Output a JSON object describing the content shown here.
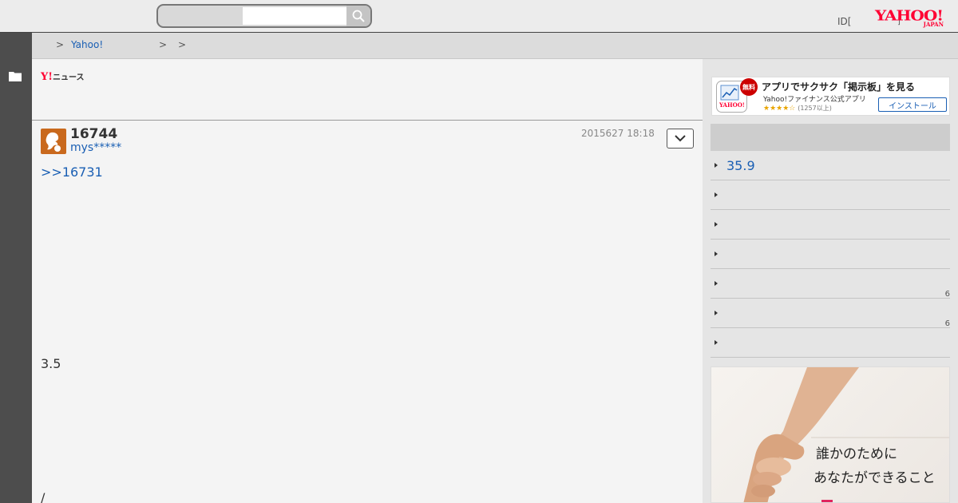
{
  "header": {
    "search": {
      "placeholder": "",
      "value": ""
    },
    "id_text": "ID[",
    "id_mark": "]",
    "logo": {
      "main": "YAHOO!",
      "sub": "JAPAN"
    }
  },
  "breadcrumb": {
    "sep1": ">",
    "link": "Yahoo!",
    "sep2": ">",
    "sep3": ">"
  },
  "main": {
    "news_logo": {
      "y": "Y!",
      "label": "ニュース"
    },
    "post": {
      "number": "16744",
      "user": "mys*****",
      "date": "2015627 18:18",
      "reply": ">>16731",
      "value": "3.5",
      "tail": "/"
    }
  },
  "sidebar": {
    "app_ad": {
      "badge": "無料",
      "title": "アプリでサクサク「掲示板」を見る",
      "subtitle": "Yahoo!ファイナンス公式アプリ",
      "stars": "★★★★☆",
      "rating_count": "(1257以上)",
      "install": "インストール",
      "icon_logo": "YAHOO!"
    },
    "items": [
      {
        "label": "35.9",
        "count": ""
      },
      {
        "label": "",
        "count": ""
      },
      {
        "label": "",
        "count": ""
      },
      {
        "label": "",
        "count": ""
      },
      {
        "label": "",
        "count": "6"
      },
      {
        "label": "",
        "count": "6"
      },
      {
        "label": "",
        "count": ""
      }
    ],
    "banner": {
      "line1": "誰かのために",
      "line2": "あなたができること"
    }
  },
  "colors": {
    "brand_red": "#ff0033",
    "link_blue": "#1a5fb4",
    "left_rail": "#4d4d4d",
    "avatar_orange": "#c9691d"
  }
}
